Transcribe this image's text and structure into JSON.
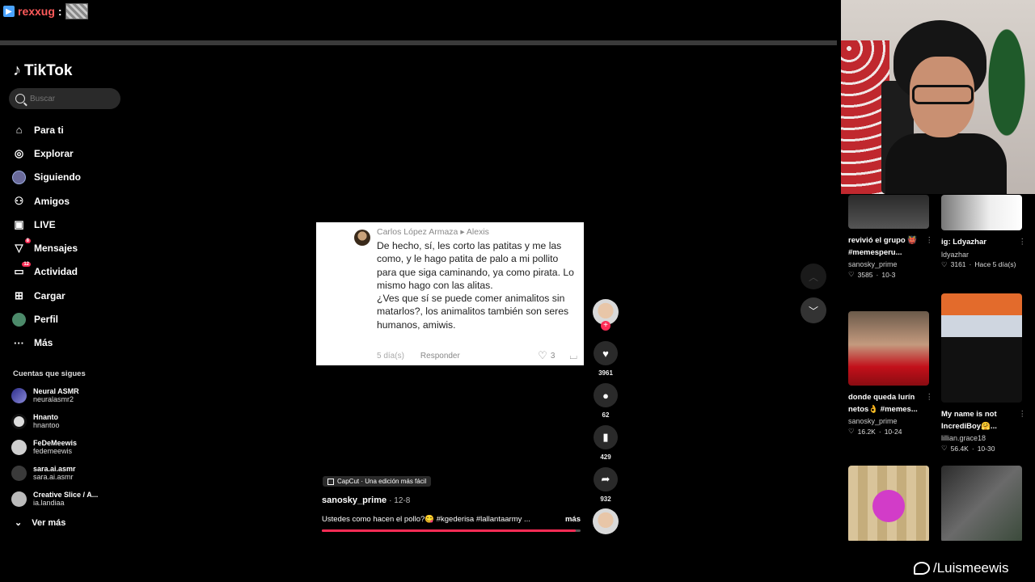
{
  "stream": {
    "username": "rexxug",
    "colon": ":",
    "handle": "/Luismeewis"
  },
  "app": {
    "name": "TikTok"
  },
  "search": {
    "placeholder": "Buscar"
  },
  "nav": [
    {
      "label": "Para ti",
      "icon": "home-icon"
    },
    {
      "label": "Explorar",
      "icon": "compass-icon"
    },
    {
      "label": "Siguiendo",
      "icon": "following-avatar-icon"
    },
    {
      "label": "Amigos",
      "icon": "friends-icon"
    },
    {
      "label": "LIVE",
      "icon": "live-icon"
    },
    {
      "label": "Mensajes",
      "icon": "messages-icon",
      "badge": "8"
    },
    {
      "label": "Actividad",
      "icon": "activity-icon",
      "badge": "12"
    },
    {
      "label": "Cargar",
      "icon": "upload-icon"
    },
    {
      "label": "Perfil",
      "icon": "profile-icon"
    },
    {
      "label": "Más",
      "icon": "more-icon"
    }
  ],
  "following": {
    "title": "Cuentas que sigues",
    "accounts": [
      {
        "name": "Neural ASMR",
        "handle": "neuralasmr2"
      },
      {
        "name": "Hnanto",
        "handle": "hnantoo"
      },
      {
        "name": "FeDeMeewis",
        "handle": "fedemeewis"
      },
      {
        "name": "sara.ai.asmr",
        "handle": "sara.ai.asmr"
      },
      {
        "name": "Creative Slice / A...",
        "handle": "ia.landiaa"
      }
    ],
    "more": "Ver más"
  },
  "comment": {
    "author": "Carlos López Armaza",
    "reply_to": "Alexis",
    "text": "De hecho, sí, les corto las patitas y me las como, y le hago patita de palo a mi pollito para que siga caminando, ya como pirata. Lo mismo hago con las alitas.\n¿Ves que sí se puede comer animalitos sin matarlos?, los animalitos también son seres humanos, amiwis.",
    "age": "5 día(s)",
    "reply_label": "Responder",
    "likes": "3"
  },
  "rail": {
    "likes": "3961",
    "comments": "62",
    "saves": "429",
    "shares": "932"
  },
  "video": {
    "capcut": "CapCut · Una edición más fácil",
    "author": "sanosky_prime",
    "date": "12-8",
    "desc": "Ustedes como hacen el pollo?😋 #kgederisa #lallantaarmy ...",
    "more": "más",
    "progress": 0.98
  },
  "feed": [
    {
      "title": "revivió el grupo 👹 #memesperu...",
      "author": "sanosky_prime",
      "likes": "3585",
      "date": "10-3"
    },
    {
      "title": "ig: Ldyazhar",
      "author": "ldyazhar",
      "likes": "3161",
      "date": "Hace 5 día(s)"
    },
    {
      "title": "donde queda lurín netos👌 #memes...",
      "author": "sanosky_prime",
      "likes": "16.2K",
      "date": "10-24"
    },
    {
      "title": "My name is not IncrediBoy🤗...",
      "author": "lillian.grace18",
      "likes": "56.4K",
      "date": "10-30"
    }
  ],
  "colors": {
    "accent": "#fe2c55",
    "stream_name": "#ff5a5a"
  }
}
